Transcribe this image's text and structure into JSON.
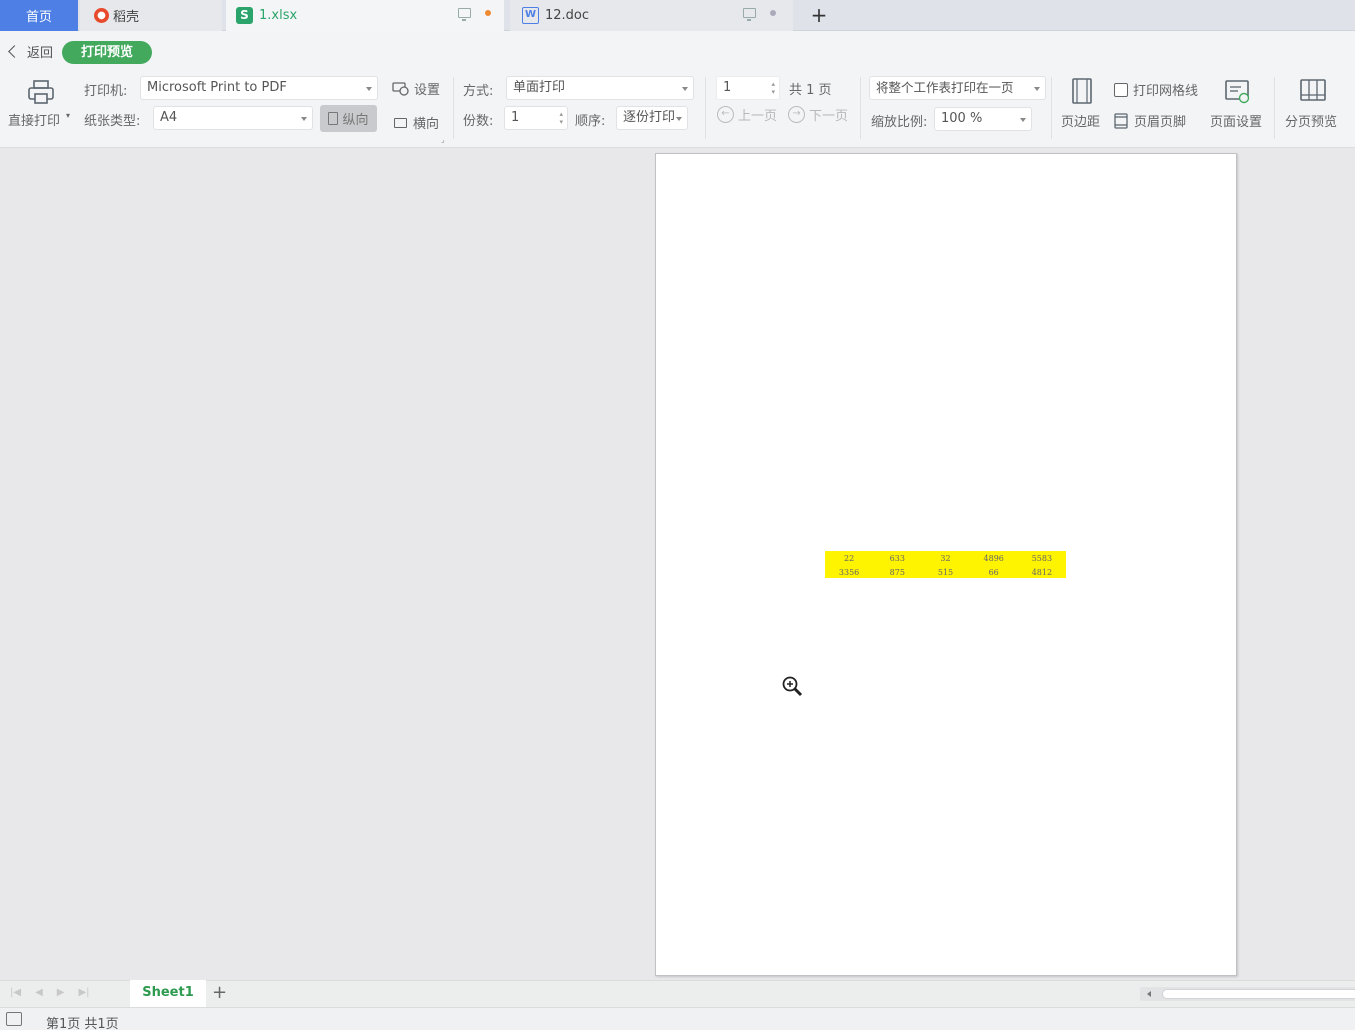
{
  "tabs": {
    "home": "首页",
    "daoke": "稻壳",
    "xlsx": "1.xlsx",
    "doc": "12.doc",
    "add": "+"
  },
  "nav": {
    "back": "返回",
    "mode": "打印预览"
  },
  "toolbar": {
    "direct_print": "直接打印",
    "printer_label": "打印机:",
    "printer_value": "Microsoft Print to PDF",
    "paper_label": "纸张类型:",
    "paper_value": "A4",
    "settings": "设置",
    "portrait": "纵向",
    "landscape": "横向",
    "method_label": "方式:",
    "method_value": "单面打印",
    "copies_label": "份数:",
    "copies_value": "1",
    "order_label": "顺序:",
    "order_value": "逐份打印",
    "page_input": "1",
    "page_total": "共 1 页",
    "prev_page": "上一页",
    "next_page": "下一页",
    "fit_value": "将整个工作表打印在一页",
    "scale_label": "缩放比例:",
    "scale_value": "100 %",
    "margins": "页边距",
    "gridlines": "打印网格线",
    "header_footer": "页眉页脚",
    "page_setup": "页面设置",
    "page_break_preview": "分页预览"
  },
  "preview_table": {
    "rows": [
      [
        "22",
        "633",
        "32",
        "4896",
        "5583"
      ],
      [
        "3356",
        "875",
        "515",
        "66",
        "4812"
      ]
    ],
    "fill_color": "#fff400"
  },
  "sheetbar": {
    "sheet_name": "Sheet1",
    "add": "+"
  },
  "status": {
    "page_info": "第1页 共1页"
  },
  "colors": {
    "accent_blue": "#4d7fe4",
    "preview_green": "#42a95d",
    "sheet_green": "#2d9a4f"
  }
}
